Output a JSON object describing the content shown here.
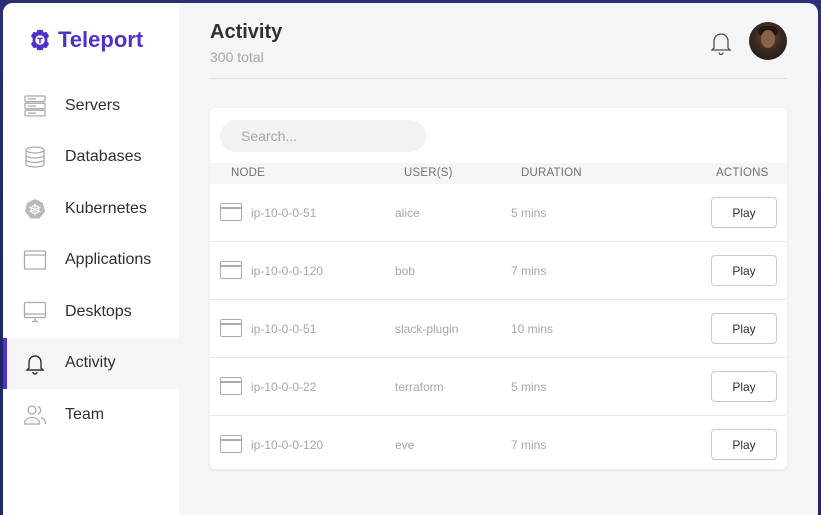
{
  "brand": {
    "name": "Teleport"
  },
  "sidebar": {
    "items": [
      {
        "label": "Servers",
        "icon": "server-icon",
        "active": false
      },
      {
        "label": "Databases",
        "icon": "database-icon",
        "active": false
      },
      {
        "label": "Kubernetes",
        "icon": "kubernetes-icon",
        "active": false
      },
      {
        "label": "Applications",
        "icon": "application-icon",
        "active": false
      },
      {
        "label": "Desktops",
        "icon": "desktop-icon",
        "active": false
      },
      {
        "label": "Activity",
        "icon": "bell-icon",
        "active": true
      },
      {
        "label": "Team",
        "icon": "team-icon",
        "active": false
      }
    ]
  },
  "header": {
    "title": "Activity",
    "subtitle": "300 total"
  },
  "search": {
    "placeholder": "Search..."
  },
  "table": {
    "columns": {
      "node": "NODE",
      "users": "USER(S)",
      "duration": "DURATION",
      "actions": "ACTIONS"
    },
    "rows": [
      {
        "node": "ip-10-0-0-51",
        "user": "alice",
        "duration": "5 mins",
        "action": "Play"
      },
      {
        "node": "ip-10-0-0-120",
        "user": "bob",
        "duration": "7 mins",
        "action": "Play"
      },
      {
        "node": "ip-10-0-0-51",
        "user": "slack-plugin",
        "duration": "10 mins",
        "action": "Play"
      },
      {
        "node": "ip-10-0-0-22",
        "user": "terraform",
        "duration": "5 mins",
        "action": "Play"
      },
      {
        "node": "ip-10-0-0-120",
        "user": "eve",
        "duration": "7 mins",
        "action": "Play"
      }
    ]
  },
  "colors": {
    "brand": "#512fc9",
    "background": "#22286a"
  }
}
